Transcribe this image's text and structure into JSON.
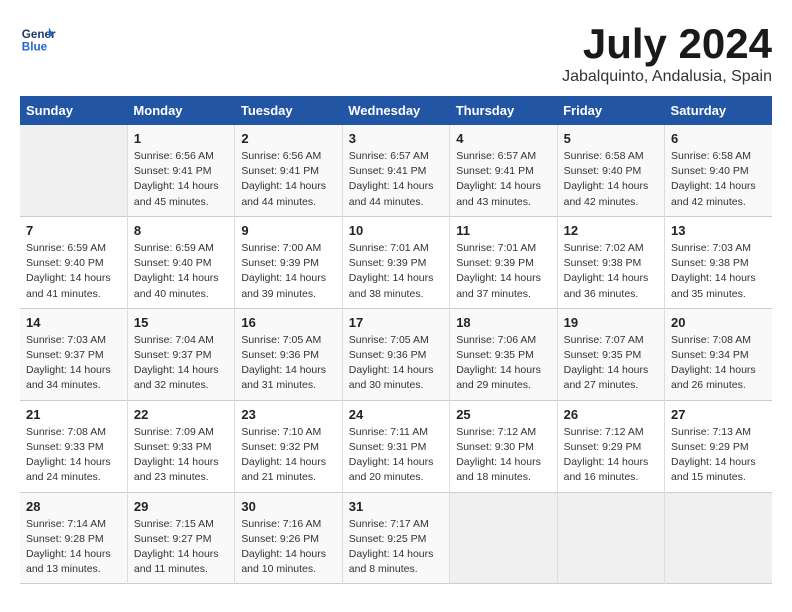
{
  "header": {
    "logo_line1": "General",
    "logo_line2": "Blue",
    "main_title": "July 2024",
    "subtitle": "Jabalquinto, Andalusia, Spain"
  },
  "calendar": {
    "days_of_week": [
      "Sunday",
      "Monday",
      "Tuesday",
      "Wednesday",
      "Thursday",
      "Friday",
      "Saturday"
    ],
    "weeks": [
      [
        {
          "day": "",
          "info": ""
        },
        {
          "day": "1",
          "info": "Sunrise: 6:56 AM\nSunset: 9:41 PM\nDaylight: 14 hours\nand 45 minutes."
        },
        {
          "day": "2",
          "info": "Sunrise: 6:56 AM\nSunset: 9:41 PM\nDaylight: 14 hours\nand 44 minutes."
        },
        {
          "day": "3",
          "info": "Sunrise: 6:57 AM\nSunset: 9:41 PM\nDaylight: 14 hours\nand 44 minutes."
        },
        {
          "day": "4",
          "info": "Sunrise: 6:57 AM\nSunset: 9:41 PM\nDaylight: 14 hours\nand 43 minutes."
        },
        {
          "day": "5",
          "info": "Sunrise: 6:58 AM\nSunset: 9:40 PM\nDaylight: 14 hours\nand 42 minutes."
        },
        {
          "day": "6",
          "info": "Sunrise: 6:58 AM\nSunset: 9:40 PM\nDaylight: 14 hours\nand 42 minutes."
        }
      ],
      [
        {
          "day": "7",
          "info": "Sunrise: 6:59 AM\nSunset: 9:40 PM\nDaylight: 14 hours\nand 41 minutes."
        },
        {
          "day": "8",
          "info": "Sunrise: 6:59 AM\nSunset: 9:40 PM\nDaylight: 14 hours\nand 40 minutes."
        },
        {
          "day": "9",
          "info": "Sunrise: 7:00 AM\nSunset: 9:39 PM\nDaylight: 14 hours\nand 39 minutes."
        },
        {
          "day": "10",
          "info": "Sunrise: 7:01 AM\nSunset: 9:39 PM\nDaylight: 14 hours\nand 38 minutes."
        },
        {
          "day": "11",
          "info": "Sunrise: 7:01 AM\nSunset: 9:39 PM\nDaylight: 14 hours\nand 37 minutes."
        },
        {
          "day": "12",
          "info": "Sunrise: 7:02 AM\nSunset: 9:38 PM\nDaylight: 14 hours\nand 36 minutes."
        },
        {
          "day": "13",
          "info": "Sunrise: 7:03 AM\nSunset: 9:38 PM\nDaylight: 14 hours\nand 35 minutes."
        }
      ],
      [
        {
          "day": "14",
          "info": "Sunrise: 7:03 AM\nSunset: 9:37 PM\nDaylight: 14 hours\nand 34 minutes."
        },
        {
          "day": "15",
          "info": "Sunrise: 7:04 AM\nSunset: 9:37 PM\nDaylight: 14 hours\nand 32 minutes."
        },
        {
          "day": "16",
          "info": "Sunrise: 7:05 AM\nSunset: 9:36 PM\nDaylight: 14 hours\nand 31 minutes."
        },
        {
          "day": "17",
          "info": "Sunrise: 7:05 AM\nSunset: 9:36 PM\nDaylight: 14 hours\nand 30 minutes."
        },
        {
          "day": "18",
          "info": "Sunrise: 7:06 AM\nSunset: 9:35 PM\nDaylight: 14 hours\nand 29 minutes."
        },
        {
          "day": "19",
          "info": "Sunrise: 7:07 AM\nSunset: 9:35 PM\nDaylight: 14 hours\nand 27 minutes."
        },
        {
          "day": "20",
          "info": "Sunrise: 7:08 AM\nSunset: 9:34 PM\nDaylight: 14 hours\nand 26 minutes."
        }
      ],
      [
        {
          "day": "21",
          "info": "Sunrise: 7:08 AM\nSunset: 9:33 PM\nDaylight: 14 hours\nand 24 minutes."
        },
        {
          "day": "22",
          "info": "Sunrise: 7:09 AM\nSunset: 9:33 PM\nDaylight: 14 hours\nand 23 minutes."
        },
        {
          "day": "23",
          "info": "Sunrise: 7:10 AM\nSunset: 9:32 PM\nDaylight: 14 hours\nand 21 minutes."
        },
        {
          "day": "24",
          "info": "Sunrise: 7:11 AM\nSunset: 9:31 PM\nDaylight: 14 hours\nand 20 minutes."
        },
        {
          "day": "25",
          "info": "Sunrise: 7:12 AM\nSunset: 9:30 PM\nDaylight: 14 hours\nand 18 minutes."
        },
        {
          "day": "26",
          "info": "Sunrise: 7:12 AM\nSunset: 9:29 PM\nDaylight: 14 hours\nand 16 minutes."
        },
        {
          "day": "27",
          "info": "Sunrise: 7:13 AM\nSunset: 9:29 PM\nDaylight: 14 hours\nand 15 minutes."
        }
      ],
      [
        {
          "day": "28",
          "info": "Sunrise: 7:14 AM\nSunset: 9:28 PM\nDaylight: 14 hours\nand 13 minutes."
        },
        {
          "day": "29",
          "info": "Sunrise: 7:15 AM\nSunset: 9:27 PM\nDaylight: 14 hours\nand 11 minutes."
        },
        {
          "day": "30",
          "info": "Sunrise: 7:16 AM\nSunset: 9:26 PM\nDaylight: 14 hours\nand 10 minutes."
        },
        {
          "day": "31",
          "info": "Sunrise: 7:17 AM\nSunset: 9:25 PM\nDaylight: 14 hours\nand 8 minutes."
        },
        {
          "day": "",
          "info": ""
        },
        {
          "day": "",
          "info": ""
        },
        {
          "day": "",
          "info": ""
        }
      ]
    ]
  }
}
